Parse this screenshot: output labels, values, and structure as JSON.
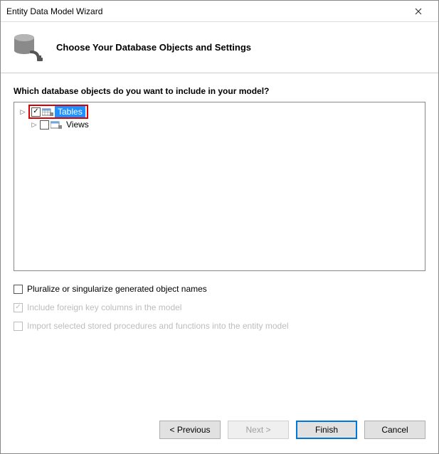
{
  "window": {
    "title": "Entity Data Model Wizard"
  },
  "header": {
    "title": "Choose Your Database Objects and Settings"
  },
  "main": {
    "prompt": "Which database objects do you want to include in your model?",
    "tree": {
      "items": [
        {
          "label": "Tables",
          "checked": true,
          "selected": true,
          "highlighted": true
        },
        {
          "label": "Views",
          "checked": false,
          "selected": false,
          "highlighted": false
        }
      ]
    },
    "options": [
      {
        "label": "Pluralize or singularize generated object names",
        "checked": false,
        "enabled": true
      },
      {
        "label": "Include foreign key columns in the model",
        "checked": true,
        "enabled": false
      },
      {
        "label": "Import selected stored procedures and functions into the entity model",
        "checked": false,
        "enabled": false
      }
    ]
  },
  "buttons": {
    "previous": "< Previous",
    "next": "Next >",
    "finish": "Finish",
    "cancel": "Cancel"
  }
}
